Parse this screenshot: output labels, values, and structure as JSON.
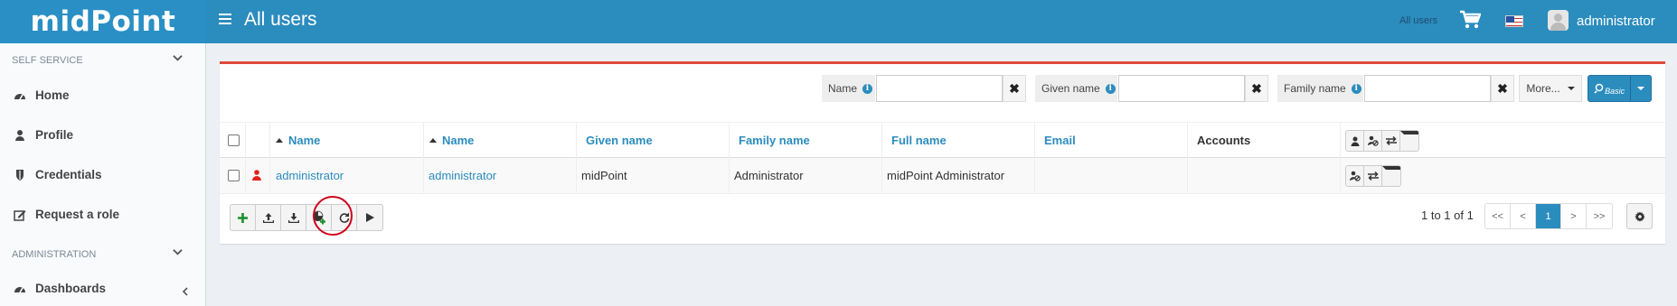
{
  "app": {
    "logo": "midPoint",
    "page_title": "All users",
    "breadcrumb": "All users",
    "user": "administrator"
  },
  "colors": {
    "brand": "#2b8cbe",
    "accent_red": "#dd4b39"
  },
  "sidebar": {
    "sections": [
      {
        "label": "SELF SERVICE"
      },
      {
        "label": "ADMINISTRATION"
      }
    ],
    "items": [
      {
        "label": "Home",
        "icon": "dashboard-icon"
      },
      {
        "label": "Profile",
        "icon": "user-icon"
      },
      {
        "label": "Credentials",
        "icon": "shield-icon"
      },
      {
        "label": "Request a role",
        "icon": "edit-icon"
      },
      {
        "label": "Dashboards",
        "icon": "dashboard-icon"
      }
    ]
  },
  "search": {
    "filters": [
      {
        "label": "Name",
        "value": ""
      },
      {
        "label": "Given name",
        "value": ""
      },
      {
        "label": "Family name",
        "value": ""
      }
    ],
    "more_label": "More...",
    "mode_label": "Basic"
  },
  "table": {
    "columns": [
      "Name",
      "Name",
      "Given name",
      "Family name",
      "Full name",
      "Email",
      "Accounts"
    ],
    "rows": [
      {
        "name": "administrator",
        "display_name": "administrator",
        "given_name": "midPoint",
        "family_name": "Administrator",
        "full_name": "midPoint Administrator",
        "email": "",
        "accounts": ""
      }
    ]
  },
  "toolbar": {
    "icons": [
      "add-icon",
      "import-icon",
      "export-icon",
      "create-report-icon",
      "refresh-icon",
      "play-icon"
    ]
  },
  "pagination": {
    "summary": "1 to 1 of 1",
    "first": "<<",
    "prev": "<",
    "current": "1",
    "next": ">",
    "last": ">>"
  }
}
